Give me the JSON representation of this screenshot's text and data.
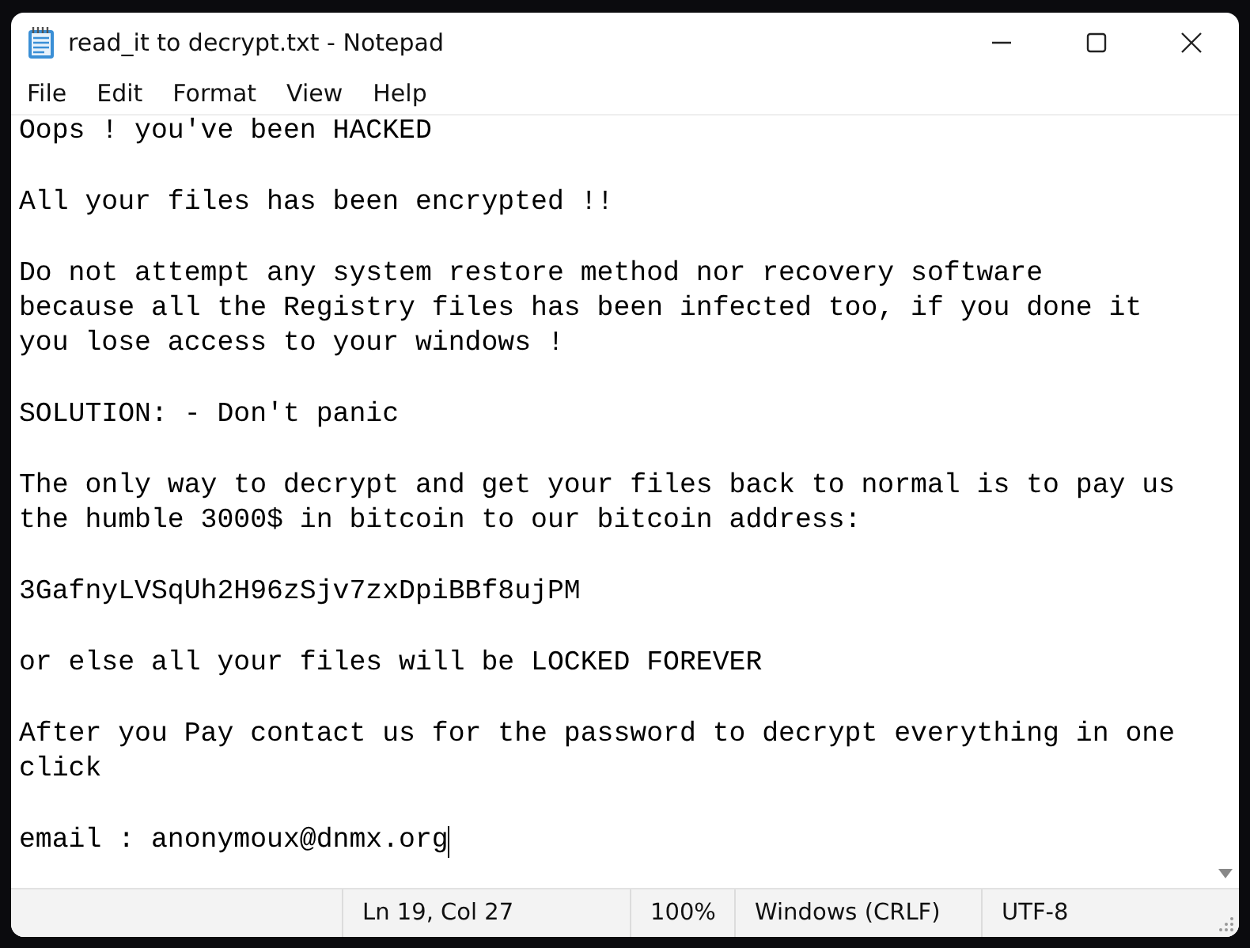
{
  "window": {
    "title": "read_it to decrypt.txt - Notepad"
  },
  "menu": [
    "File",
    "Edit",
    "Format",
    "View",
    "Help"
  ],
  "editor": {
    "paragraphs": [
      [
        "Oops ! you've been HACKED"
      ],
      [
        "All your files has been encrypted !!"
      ],
      [
        "Do not attempt any system restore method nor recovery software",
        "because all the Registry files has been infected too, if you done it",
        "you lose access to your windows !"
      ],
      [
        "SOLUTION: - Don't panic"
      ],
      [
        "The only way to decrypt and get your files back to normal is to pay us",
        "the humble 3000$ in bitcoin to our bitcoin address:"
      ],
      [
        "3GafnyLVSqUh2H96zSjv7zxDpiBBf8ujPM"
      ],
      [
        "or else all your files will be LOCKED FOREVER"
      ],
      [
        "After you Pay contact us for the password to decrypt everything in one",
        "click"
      ],
      [
        "email : anonymoux@dnmx.org"
      ]
    ]
  },
  "status_bar": {
    "position": "Ln 19, Col 27",
    "zoom": "100%",
    "line_endings": "Windows (CRLF)",
    "encoding": "UTF-8"
  }
}
